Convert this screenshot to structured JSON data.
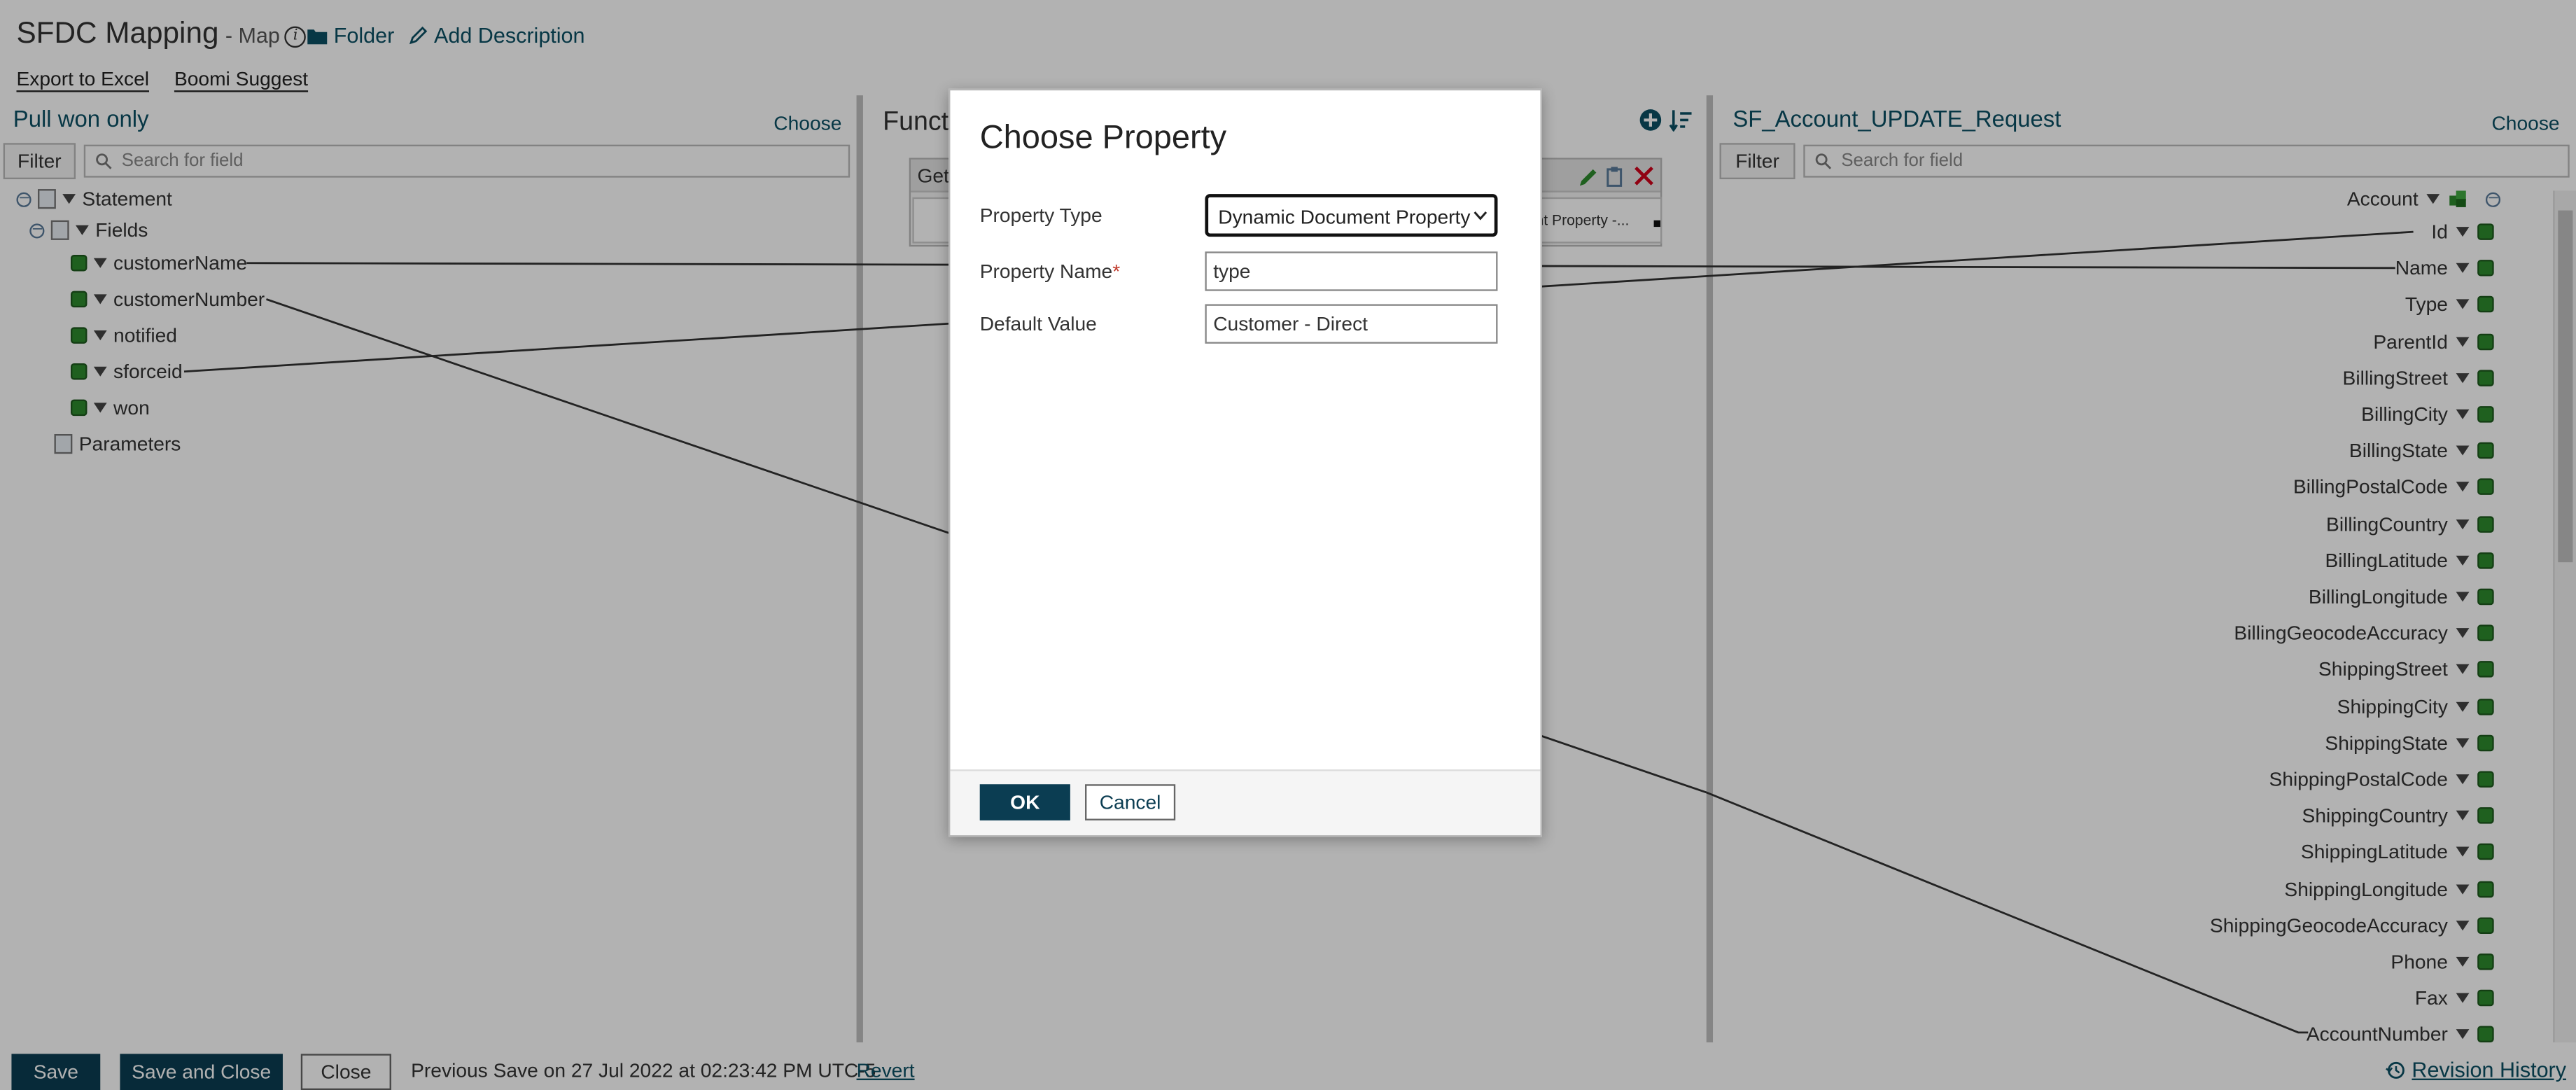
{
  "header": {
    "title": "SFDC Mapping",
    "subtitle": "- Map",
    "folder_label": "Folder",
    "add_description_label": "Add Description",
    "export_label": "Export to Excel",
    "suggest_label": "Boomi Suggest"
  },
  "source": {
    "title": "Pull won only",
    "choose_label": "Choose",
    "filter_label": "Filter",
    "search_placeholder": "Search for field",
    "root": "Statement",
    "group": "Fields",
    "fields": [
      "customerName",
      "customerNumber",
      "notified",
      "sforceid",
      "won"
    ],
    "params": "Parameters"
  },
  "functions": {
    "title": "Funct",
    "item_label": "Get",
    "item_value": "ent Property -..."
  },
  "target": {
    "title": "SF_Account_UPDATE_Request",
    "choose_label": "Choose",
    "filter_label": "Filter",
    "search_placeholder": "Search for field",
    "root": "Account",
    "fields": [
      "Id",
      "Name",
      "Type",
      "ParentId",
      "BillingStreet",
      "BillingCity",
      "BillingState",
      "BillingPostalCode",
      "BillingCountry",
      "BillingLatitude",
      "BillingLongitude",
      "BillingGeocodeAccuracy",
      "ShippingStreet",
      "ShippingCity",
      "ShippingState",
      "ShippingPostalCode",
      "ShippingCountry",
      "ShippingLatitude",
      "ShippingLongitude",
      "ShippingGeocodeAccuracy",
      "Phone",
      "Fax",
      "AccountNumber"
    ]
  },
  "footer": {
    "save": "Save",
    "save_close": "Save and Close",
    "close": "Close",
    "status": "Previous Save on 27 Jul 2022 at 02:23:42 PM UTC-5",
    "revert": "Revert",
    "revision_history": "Revision History"
  },
  "modal": {
    "title": "Choose Property",
    "type_label": "Property Type",
    "type_value": "Dynamic Document Property",
    "name_label": "Property Name",
    "required_mark": "*",
    "name_value": "type",
    "default_label": "Default Value",
    "default_value": "Customer - Direct",
    "ok": "OK",
    "cancel": "Cancel"
  },
  "colors": {
    "accent": "#0b4f63",
    "button_dark": "#0b3d52",
    "field_icon": "#2d8a2d",
    "delete": "#d0021b"
  },
  "icons": {
    "info": "info-icon",
    "folder": "folder-icon",
    "pencil": "pencil-icon",
    "search": "search-icon",
    "history": "history-icon"
  }
}
